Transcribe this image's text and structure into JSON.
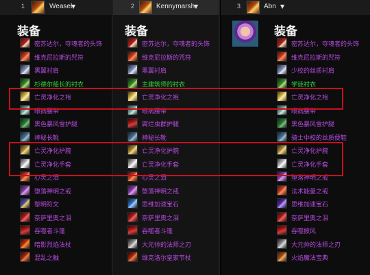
{
  "players": [
    {
      "rank": "1",
      "name": "Weasel",
      "title": "装备",
      "items": [
        {
          "name": "密苏达尔，夺魂者的头饰",
          "q": "ep",
          "icon": "ic-shoulder",
          "icon_name": "helm-icon"
        },
        {
          "name": "维克尼拉斯的咒符",
          "q": "ep",
          "icon": "ic-ring",
          "icon_name": "necklace-icon"
        },
        {
          "name": "黑翼衬肩",
          "q": "ep",
          "icon": "ic-wing",
          "icon_name": "shoulders-icon"
        },
        {
          "name": "杉德尔船长的衬衣",
          "q": "gr",
          "icon": "ic-shirt",
          "icon_name": "shirt-icon"
        },
        {
          "name": "亡灵净化之袍",
          "q": "ep",
          "icon": "ic-chest",
          "icon_name": "robe-icon"
        },
        {
          "name": "眼病腰带",
          "q": "ep",
          "icon": "ic-belt",
          "icon_name": "belt-icon"
        },
        {
          "name": "黑色暴风雪护腿",
          "q": "ep",
          "icon": "ic-legs",
          "icon_name": "legs-icon"
        },
        {
          "name": "神秘长靴",
          "q": "ep",
          "icon": "ic-boots",
          "icon_name": "boots-icon"
        },
        {
          "name": "亡灵净化护腕",
          "q": "ep",
          "icon": "ic-bracer",
          "icon_name": "bracer-icon"
        },
        {
          "name": "亡灵净化手套",
          "q": "ep",
          "icon": "ic-glove",
          "icon_name": "gloves-icon"
        },
        {
          "name": "心灵之泪",
          "q": "ep",
          "icon": "ic-ring",
          "icon_name": "ring-icon"
        },
        {
          "name": "堕落神明之戒",
          "q": "ep",
          "icon": "ic-ring2",
          "icon_name": "ring-icon"
        },
        {
          "name": "黎明符文",
          "q": "ep",
          "icon": "ic-rune",
          "icon_name": "trinket-icon"
        },
        {
          "name": "奈萨里奥之泪",
          "q": "ep",
          "icon": "ic-tear",
          "icon_name": "trinket-icon"
        },
        {
          "name": "吞噬者斗篷",
          "q": "ep",
          "icon": "ic-cloak",
          "icon_name": "cloak-icon"
        },
        {
          "name": "暗影烈焰法杖",
          "q": "ep",
          "icon": "ic-staff",
          "icon_name": "staff-icon"
        },
        {
          "name": "混乱之触",
          "q": "ep",
          "icon": "ic-wand",
          "icon_name": "wand-icon"
        }
      ]
    },
    {
      "rank": "2",
      "name": "Kennymarsh",
      "title": "装备",
      "items": [
        {
          "name": "密苏达尔，夺魂者的头饰",
          "q": "ep",
          "icon": "ic-shoulder",
          "icon_name": "helm-icon"
        },
        {
          "name": "维克尼拉斯的咒符",
          "q": "ep",
          "icon": "ic-ring",
          "icon_name": "necklace-icon"
        },
        {
          "name": "黑翼衬肩",
          "q": "ep",
          "icon": "ic-wing",
          "icon_name": "shoulders-icon"
        },
        {
          "name": "主建筑师的衬衣",
          "q": "gr",
          "icon": "ic-shirt",
          "icon_name": "shirt-icon"
        },
        {
          "name": "亡灵净化之袍",
          "q": "ep",
          "icon": "ic-chest",
          "icon_name": "robe-icon"
        },
        {
          "name": "眼病腰带",
          "q": "ep",
          "icon": "ic-belt",
          "icon_name": "belt-icon"
        },
        {
          "name": "腐烂虫群护腿",
          "q": "ep",
          "icon": "ic-cloak",
          "icon_name": "legs-icon"
        },
        {
          "name": "神秘长靴",
          "q": "ep",
          "icon": "ic-boots",
          "icon_name": "boots-icon"
        },
        {
          "name": "亡灵净化护腕",
          "q": "ep",
          "icon": "ic-bracer",
          "icon_name": "bracer-icon"
        },
        {
          "name": "亡灵净化手套",
          "q": "ep",
          "icon": "ic-glove",
          "icon_name": "gloves-icon"
        },
        {
          "name": "心灵之泪",
          "q": "ep",
          "icon": "ic-ring",
          "icon_name": "ring-icon"
        },
        {
          "name": "堕落神明之戒",
          "q": "ep",
          "icon": "ic-ring2",
          "icon_name": "ring-icon"
        },
        {
          "name": "思维加速宝石",
          "q": "ep",
          "icon": "ic-trinket",
          "icon_name": "trinket-icon"
        },
        {
          "name": "奈萨里奥之泪",
          "q": "ep",
          "icon": "ic-tear",
          "icon_name": "trinket-icon"
        },
        {
          "name": "吞噬者斗篷",
          "q": "ep",
          "icon": "ic-cloak",
          "icon_name": "cloak-icon"
        },
        {
          "name": "大元帅的法师之刃",
          "q": "ep",
          "icon": "ic-dagger",
          "icon_name": "dagger-icon"
        },
        {
          "name": "维克洛尔皇家节杖",
          "q": "ep",
          "icon": "ic-wand",
          "icon_name": "scepter-icon"
        }
      ]
    },
    {
      "rank": "3",
      "name": "Abn",
      "title": "装备",
      "items": [
        {
          "name": "密苏达尔，夺魂者的头饰",
          "q": "ep",
          "icon": "ic-shoulder",
          "icon_name": "helm-icon"
        },
        {
          "name": "维克尼拉斯的咒符",
          "q": "ep",
          "icon": "ic-ring",
          "icon_name": "necklace-icon"
        },
        {
          "name": "少校的丝质衬肩",
          "q": "ep",
          "icon": "ic-wing",
          "icon_name": "shoulders-icon"
        },
        {
          "name": "学徒衬衣",
          "q": "gr",
          "icon": "ic-shirt",
          "icon_name": "shirt-icon"
        },
        {
          "name": "亡灵净化之袍",
          "q": "ep",
          "icon": "ic-chest",
          "icon_name": "robe-icon"
        },
        {
          "name": "眼病腰带",
          "q": "ep",
          "icon": "ic-belt",
          "icon_name": "belt-icon"
        },
        {
          "name": "黑色暴风雪护腿",
          "q": "ep",
          "icon": "ic-legs",
          "icon_name": "legs-icon"
        },
        {
          "name": "骑士中校的丝质便鞋",
          "q": "ep",
          "icon": "ic-boots",
          "icon_name": "boots-icon"
        },
        {
          "name": "亡灵净化护腕",
          "q": "ep",
          "icon": "ic-bracer",
          "icon_name": "bracer-icon"
        },
        {
          "name": "亡灵净化手套",
          "q": "ep",
          "icon": "ic-glove",
          "icon_name": "gloves-icon"
        },
        {
          "name": "堕落神明之戒",
          "q": "ep",
          "icon": "ic-ring2",
          "icon_name": "ring-icon"
        },
        {
          "name": "法术能量之戒",
          "q": "ep",
          "icon": "ic-ring",
          "icon_name": "ring-icon"
        },
        {
          "name": "思维加速宝石",
          "q": "ep",
          "icon": "ic-gem",
          "icon_name": "trinket-icon"
        },
        {
          "name": "奈萨里奥之泪",
          "q": "ep",
          "icon": "ic-tear",
          "icon_name": "trinket-icon"
        },
        {
          "name": "吞噬披风",
          "q": "ep",
          "icon": "ic-cloak",
          "icon_name": "cloak-icon"
        },
        {
          "name": "大元帅的法师之刃",
          "q": "ep",
          "icon": "ic-dagger",
          "icon_name": "dagger-icon"
        },
        {
          "name": "火焰魔法宝典",
          "q": "ep",
          "icon": "ic-book",
          "icon_name": "book-icon"
        }
      ]
    }
  ],
  "colors": {
    "epic": "#b64ae0",
    "uncommon": "#2edc3a",
    "highlight_box": "#c8101e"
  },
  "highlight_boxes": [
    "robe-row",
    "bracer-and-gloves-rows"
  ]
}
